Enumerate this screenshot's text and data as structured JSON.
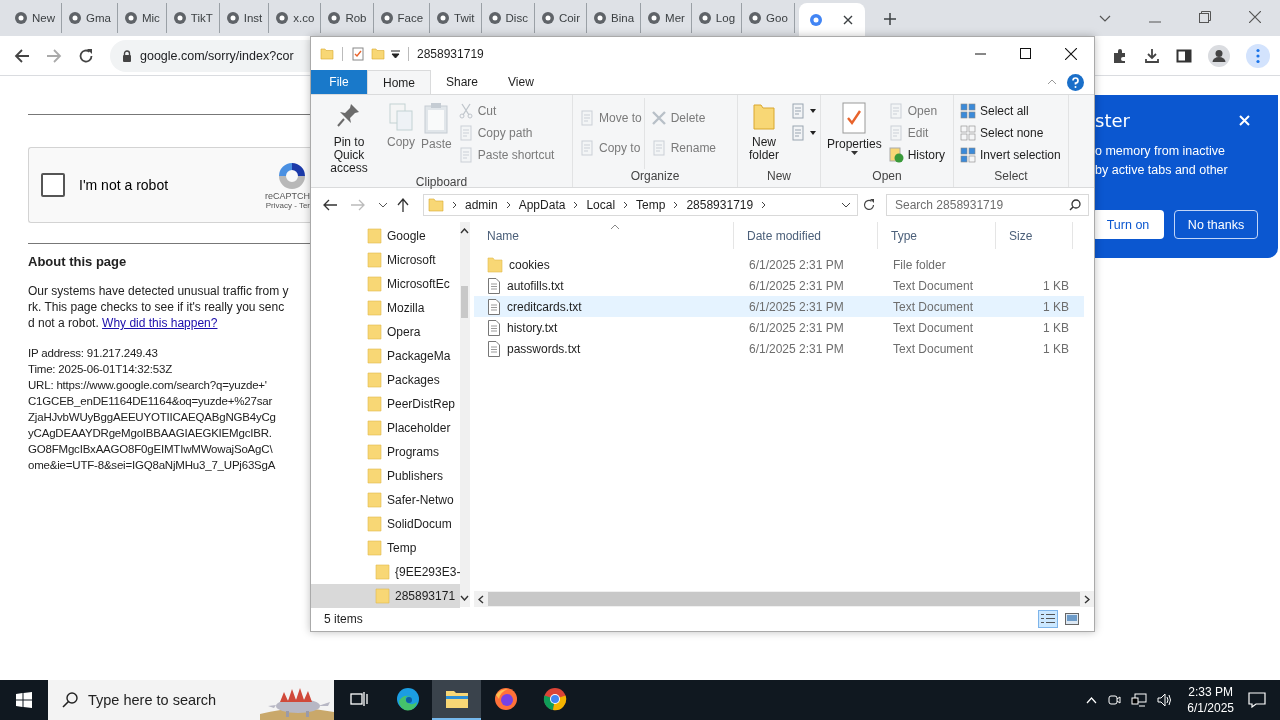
{
  "browser": {
    "tabs": [
      {
        "title": "New",
        "selected": false
      },
      {
        "title": "Gma",
        "selected": false
      },
      {
        "title": "Mic",
        "selected": false
      },
      {
        "title": "TikT",
        "selected": false
      },
      {
        "title": "Inst",
        "selected": false
      },
      {
        "title": "x.co",
        "selected": false
      },
      {
        "title": "Rob",
        "selected": false
      },
      {
        "title": "Face",
        "selected": false
      },
      {
        "title": "Twit",
        "selected": false
      },
      {
        "title": "Disc",
        "selected": false
      },
      {
        "title": "Coir",
        "selected": false
      },
      {
        "title": "Bina",
        "selected": false
      },
      {
        "title": "Mer",
        "selected": false
      },
      {
        "title": "Log",
        "selected": false
      },
      {
        "title": "Goo",
        "selected": false
      },
      {
        "selected": true
      }
    ],
    "address": "google.com/sorry/index?cor",
    "popup": {
      "title": "ster",
      "lines": [
        "o memory from inactive",
        "by active tabs and other"
      ],
      "buttons": [
        {
          "label": "Turn on",
          "kind": "primary"
        },
        {
          "label": "No thanks",
          "kind": "secondary"
        }
      ]
    }
  },
  "page": {
    "captcha": {
      "label": "I'm not a robot",
      "checked": false,
      "brand": "reCAPTCH",
      "terms": "Privacy - Ter"
    },
    "heading": "About this page",
    "paragraph": {
      "lines": [
        "Our systems have detected unusual traffic from y",
        "rk. This page checks to see if it's really you senc",
        "d not a robot."
      ],
      "link": "Why did this happen?"
    },
    "details": [
      "IP address: 91.217.249.43",
      "Time: 2025-06-01T14:32:53Z",
      "URL: https://www.google.com/search?q=yuzde+'",
      "C1GCEB_enDE1164DE1164&oq=yuzde+%27sar",
      "ZjaHJvbWUyBggAEEUYOTIICAEQABgNGB4yCg",
      "yCAgDEAAYDRgeMgoIBBAAGIAEGKIEMgcIBR.",
      "GO8FMgcIBxAAGO8F0gEIMTIwMWowajSoAgC\\",
      "ome&ie=UTF-8&sei=IGQ8aNjMHu3_7_UPj63SgA"
    ]
  },
  "explorer": {
    "title": "2858931719",
    "ribbon_tabs": [
      {
        "label": "File",
        "kind": "file",
        "selected": false
      },
      {
        "label": "Home",
        "kind": "tab",
        "selected": true
      },
      {
        "label": "Share",
        "kind": "tab",
        "selected": false
      },
      {
        "label": "View",
        "kind": "tab",
        "selected": false
      }
    ],
    "groups": [
      {
        "label": "Clipboard",
        "large": [
          {
            "label": "Pin to Quick access",
            "disabled": false
          },
          {
            "label": "Copy",
            "disabled": true
          },
          {
            "label": "Paste",
            "disabled": true
          }
        ],
        "small_columns": [
          [
            {
              "label": "Cut",
              "disabled": true
            },
            {
              "label": "Copy path",
              "disabled": true
            },
            {
              "label": "Paste shortcut",
              "disabled": true
            }
          ]
        ]
      },
      {
        "label": "Organize",
        "small_columns": [
          [
            {
              "label": "Move to",
              "disabled": true
            },
            {
              "label": "Copy to",
              "disabled": true
            }
          ],
          [
            {
              "label": "Delete",
              "disabled": true
            },
            {
              "label": "Rename",
              "disabled": true
            }
          ]
        ]
      },
      {
        "label": "New",
        "large": [
          {
            "label": "New folder",
            "disabled": false
          }
        ],
        "small_columns": [
          [
            {
              "disabled": false
            },
            {
              "disabled": false
            }
          ]
        ]
      },
      {
        "label": "Open",
        "large": [
          {
            "label": "Properties",
            "disabled": false
          }
        ],
        "small_columns": [
          [
            {
              "label": "Open",
              "disabled": true
            },
            {
              "label": "Edit",
              "disabled": true
            },
            {
              "label": "History",
              "disabled": false
            }
          ]
        ]
      },
      {
        "label": "Select",
        "small_columns": [
          [
            {
              "label": "Select all",
              "disabled": false
            },
            {
              "label": "Select none",
              "disabled": false
            },
            {
              "label": "Invert selection",
              "disabled": false
            }
          ]
        ]
      }
    ],
    "breadcrumb": [
      "admin",
      "AppData",
      "Local",
      "Temp",
      "2858931719"
    ],
    "search": {
      "placeholder": "Search 2858931719"
    },
    "tree": [
      {
        "label": "Google",
        "selected": false
      },
      {
        "label": "Microsoft",
        "selected": false
      },
      {
        "label": "MicrosoftEc",
        "selected": false
      },
      {
        "label": "Mozilla",
        "selected": false
      },
      {
        "label": "Opera",
        "selected": false
      },
      {
        "label": "PackageMa",
        "selected": false
      },
      {
        "label": "Packages",
        "selected": false
      },
      {
        "label": "PeerDistRep",
        "selected": false
      },
      {
        "label": "Placeholder",
        "selected": false
      },
      {
        "label": "Programs",
        "selected": false
      },
      {
        "label": "Publishers",
        "selected": false
      },
      {
        "label": "Safer-Netwo",
        "selected": false
      },
      {
        "label": "SolidDocum",
        "selected": false
      },
      {
        "label": "Temp",
        "selected": false,
        "children": [
          {
            "label": "{9EE293E3-",
            "selected": false
          },
          {
            "label": "285893171",
            "selected": true
          }
        ]
      }
    ],
    "columns": [
      "Name",
      "Date modified",
      "Type",
      "Size"
    ],
    "rows": [
      {
        "kind": "folder",
        "name": "cookies",
        "date": "6/1/2025 2:31 PM",
        "type": "File folder",
        "selected": false
      },
      {
        "kind": "file",
        "name": "autofills.txt",
        "date": "6/1/2025 2:31 PM",
        "type": "Text Document",
        "size": "1 KB",
        "selected": false
      },
      {
        "kind": "file",
        "name": "creditcards.txt",
        "date": "6/1/2025 2:31 PM",
        "type": "Text Document",
        "size": "1 KB",
        "selected": true
      },
      {
        "kind": "file",
        "name": "history.txt",
        "date": "6/1/2025 2:31 PM",
        "type": "Text Document",
        "size": "1 KB",
        "selected": false
      },
      {
        "kind": "file",
        "name": "passwords.txt",
        "date": "6/1/2025 2:31 PM",
        "type": "Text Document",
        "size": "1 KB",
        "selected": false
      }
    ],
    "status": "5 items",
    "view_buttons": [
      {
        "kind": "details",
        "selected": true
      },
      {
        "kind": "thumbnails",
        "selected": false
      }
    ]
  },
  "taskbar": {
    "search": {
      "placeholder": "Type here to search"
    },
    "apps": [
      {
        "kind": "taskview",
        "active": false
      },
      {
        "kind": "edge",
        "active": false
      },
      {
        "kind": "explorer",
        "active": true
      },
      {
        "kind": "firefox",
        "active": false
      },
      {
        "kind": "chrome",
        "active": false
      }
    ],
    "time": "2:33 PM",
    "date": "6/1/2025"
  }
}
